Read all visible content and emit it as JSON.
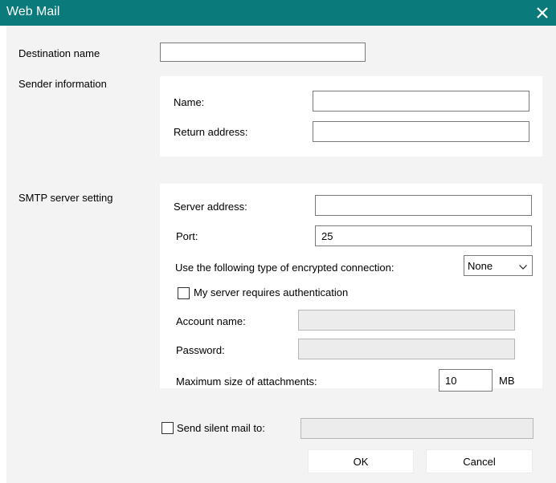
{
  "window": {
    "title": "Web Mail",
    "close_icon": "close-icon"
  },
  "destination": {
    "label": "Destination name",
    "value": ""
  },
  "sender": {
    "section_label": "Sender information",
    "name_label": "Name:",
    "name_value": "",
    "return_label": "Return address:",
    "return_value": ""
  },
  "smtp": {
    "section_label": "SMTP server setting",
    "server_label": "Server address:",
    "server_value": "",
    "port_label": "Port:",
    "port_value": "25",
    "encryption_label": "Use the following type of encrypted connection:",
    "encryption_value": "None",
    "auth_label": "My server requires authentication",
    "auth_checked": false,
    "account_label": "Account name:",
    "account_value": "",
    "password_label": "Password:",
    "password_value": "",
    "maxsize_label": "Maximum size of attachments:",
    "maxsize_value": "10",
    "maxsize_unit": "MB"
  },
  "silent": {
    "label": "Send silent mail to:",
    "checked": false,
    "value": ""
  },
  "buttons": {
    "ok": "OK",
    "cancel": "Cancel"
  }
}
